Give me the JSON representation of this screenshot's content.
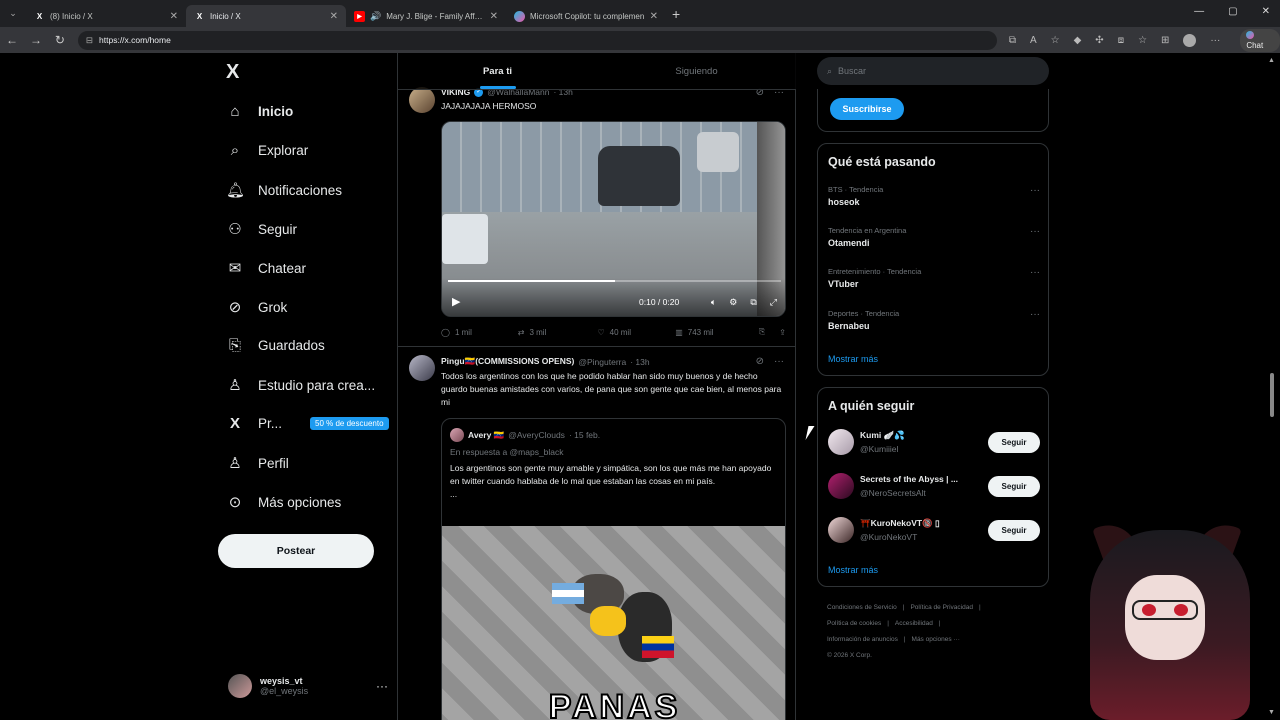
{
  "browser": {
    "tabs": [
      {
        "title": "(8) Inicio / X",
        "icon": "x-logo-icon",
        "active": false
      },
      {
        "title": "Inicio / X",
        "icon": "x-logo-icon",
        "active": true
      },
      {
        "title": "Mary J. Blige - Family Affair (O",
        "icon": "youtube-icon",
        "active": false
      },
      {
        "title": "Microsoft Copilot: tu complemen",
        "icon": "copilot-icon",
        "active": false
      }
    ],
    "new_tab": "+",
    "url": "https://x.com/home",
    "chat_label": "Chat"
  },
  "sidebar": {
    "logo": "X",
    "items": [
      {
        "label": "Inicio",
        "icon": "home-icon",
        "glyph": "⌂",
        "bold": true
      },
      {
        "label": "Explorar",
        "icon": "search-icon",
        "glyph": "⌕"
      },
      {
        "label": "Notificaciones",
        "icon": "bell-icon",
        "glyph": "♪"
      },
      {
        "label": "Seguir",
        "icon": "add-person-icon",
        "glyph": "⚇"
      },
      {
        "label": "Chatear",
        "icon": "mail-icon",
        "glyph": "✉"
      },
      {
        "label": "Grok",
        "icon": "grok-icon",
        "glyph": "⊘"
      },
      {
        "label": "Guardados",
        "icon": "bookmark-icon",
        "glyph": "⎘"
      },
      {
        "label": "Estudio para crea...",
        "icon": "studio-icon",
        "glyph": "♙"
      },
      {
        "label": "Pr...",
        "icon": "x-premium-icon",
        "glyph": "X",
        "badge": "50 % de descuento"
      },
      {
        "label": "Perfil",
        "icon": "profile-icon",
        "glyph": "♙"
      },
      {
        "label": "Más opciones",
        "icon": "more-options-icon",
        "glyph": "⊙"
      }
    ],
    "post_button": "Postear",
    "account": {
      "name": "weysis_vt",
      "handle": "@el_weysis",
      "more": "···"
    }
  },
  "feed": {
    "tabs": [
      {
        "label": "Para ti",
        "active": true
      },
      {
        "label": "Siguiendo",
        "active": false
      }
    ],
    "tweet1": {
      "name": "VIKING",
      "handle": "@WalhallaMann",
      "time": "· 13h",
      "text": "JAJAJAJAJA HERMOSO",
      "video": {
        "time": "0:10 / 0:20",
        "progress": 0.5
      },
      "actions": {
        "replies": "1 mil",
        "reposts": "3 mil",
        "likes": "40 mil",
        "views": "743 mil"
      }
    },
    "tweet2": {
      "name": "Pingu🇻🇪(COMMISSIONS OPENS)",
      "handle": "@Pinguterra",
      "time": "· 13h",
      "text": "Todos los argentinos con los que he podido hablar han sido muy buenos y de hecho guardo buenas amistades con varios, de pana que son gente que cae bien, al menos para mi",
      "quote": {
        "name": "Avery 🇻🇪",
        "handle": "@AveryClouds",
        "time": "· 15 feb.",
        "reply_to": "En respuesta a @maps_black",
        "text": "Los argentinos son gente muy amable y simpática, son los que más me han apoyado en twitter cuando hablaba de lo mal que estaban las cosas en mi país.",
        "ellipsis": "...",
        "image_caption": "PANAS"
      }
    }
  },
  "right": {
    "search_placeholder": "Buscar",
    "subscribe_button": "Suscribirse",
    "trends_title": "Qué está pasando",
    "trends": [
      {
        "context": "BTS · Tendencia",
        "topic": "hoseok"
      },
      {
        "context": "Tendencia en Argentina",
        "topic": "Otamendi"
      },
      {
        "context": "Entretenimiento · Tendencia",
        "topic": "VTuber"
      },
      {
        "context": "Deportes · Tendencia",
        "topic": "Bernabeu"
      }
    ],
    "show_more": "Mostrar más",
    "who_to_follow_title": "A quién seguir",
    "who_to_follow": [
      {
        "name": "Kumi 🪽💦",
        "handle": "@Kumiiiel",
        "button": "Seguir"
      },
      {
        "name": "Secrets of the Abyss | ...",
        "handle": "@NeroSecretsAlt",
        "button": "Seguir"
      },
      {
        "name": "⛩️KuroNekoVT🔞 ▯",
        "handle": "@KuroNekoVT",
        "button": "Seguir"
      }
    ],
    "show_more_2": "Mostrar más",
    "footer": {
      "links": [
        "Condiciones de Servicio",
        "Política de Privacidad",
        "Política de cookies",
        "Accesibilidad",
        "Información de anuncios",
        "Más opciones ···"
      ],
      "copyright": "© 2026 X Corp."
    }
  },
  "colors": {
    "accent": "#1d9bf0",
    "background": "#000000",
    "border": "#2f3336",
    "muted": "#71767b"
  }
}
